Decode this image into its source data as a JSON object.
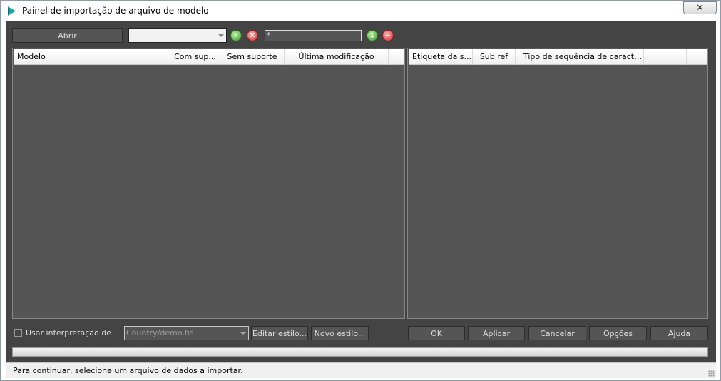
{
  "window": {
    "title": "Painel de importação de arquivo de modelo",
    "close_glyph": "✕"
  },
  "toolbar": {
    "open_label": "Abrir",
    "file_combo_value": "",
    "filter_value": "*",
    "icons": [
      "check-icon",
      "cancel-icon",
      "download-icon",
      "remove-icon"
    ]
  },
  "left_table": {
    "columns": [
      "Modelo",
      "Com sup...",
      "Sem suporte",
      "Última modificação",
      ""
    ]
  },
  "right_table": {
    "columns": [
      "Etiqueta da s...",
      "Sub ref",
      "Tipo de sequência de caracteres",
      "",
      ""
    ]
  },
  "bottom": {
    "use_interpretation_label": "Usar interpretação de",
    "use_interpretation_checked": false,
    "style_combo_value": "Country/demo.fis",
    "edit_style_label": "Editar estilo...",
    "new_style_label": "Novo estilo...",
    "ok_label": "OK",
    "apply_label": "Aplicar",
    "cancel_label": "Cancelar",
    "options_label": "Opções",
    "help_label": "Ajuda"
  },
  "status": {
    "message": "Para continuar, selecione um arquivo de dados a importar."
  },
  "colors": {
    "client_bg": "#444444",
    "panel_bg": "#555555",
    "check_green": "#3f9a2d",
    "cancel_red": "#cc2a2a"
  }
}
